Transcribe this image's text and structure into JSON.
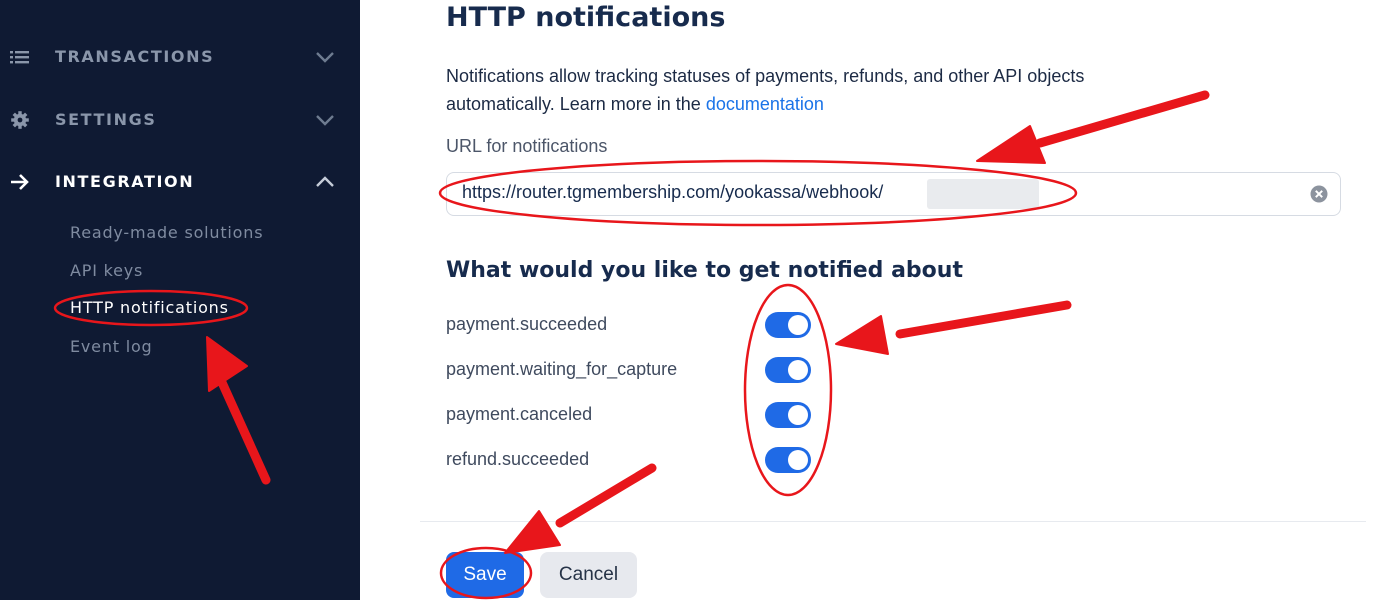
{
  "sidebar": {
    "items": [
      {
        "label": "TRANSACTIONS",
        "icon": "list-icon",
        "expanded": false
      },
      {
        "label": "SETTINGS",
        "icon": "gear-icon",
        "expanded": false
      },
      {
        "label": "INTEGRATION",
        "icon": "arrow-right-icon",
        "expanded": true
      }
    ],
    "subitems": [
      {
        "label": "Ready-made solutions"
      },
      {
        "label": "API keys"
      },
      {
        "label": "HTTP notifications",
        "active": true
      },
      {
        "label": "Event log"
      }
    ]
  },
  "main": {
    "title": "HTTP notifications",
    "description_prefix": "Notifications allow tracking statuses of payments, refunds, and other API objects automatically. Learn more in the",
    "description_link": "documentation",
    "url_label": "URL for notifications",
    "url_value": "https://router.tgmembership.com/yookassa/webhook/",
    "events_title": "What would you like to get notified about",
    "events": [
      {
        "label": "payment.succeeded",
        "enabled": true
      },
      {
        "label": "payment.waiting_for_capture",
        "enabled": true
      },
      {
        "label": "payment.canceled",
        "enabled": true
      },
      {
        "label": "refund.succeeded",
        "enabled": true
      }
    ],
    "save_label": "Save",
    "cancel_label": "Cancel"
  },
  "colors": {
    "sidebar_bg": "#0f1a33",
    "accent": "#1f6ae6",
    "annotation": "#e8161b"
  }
}
